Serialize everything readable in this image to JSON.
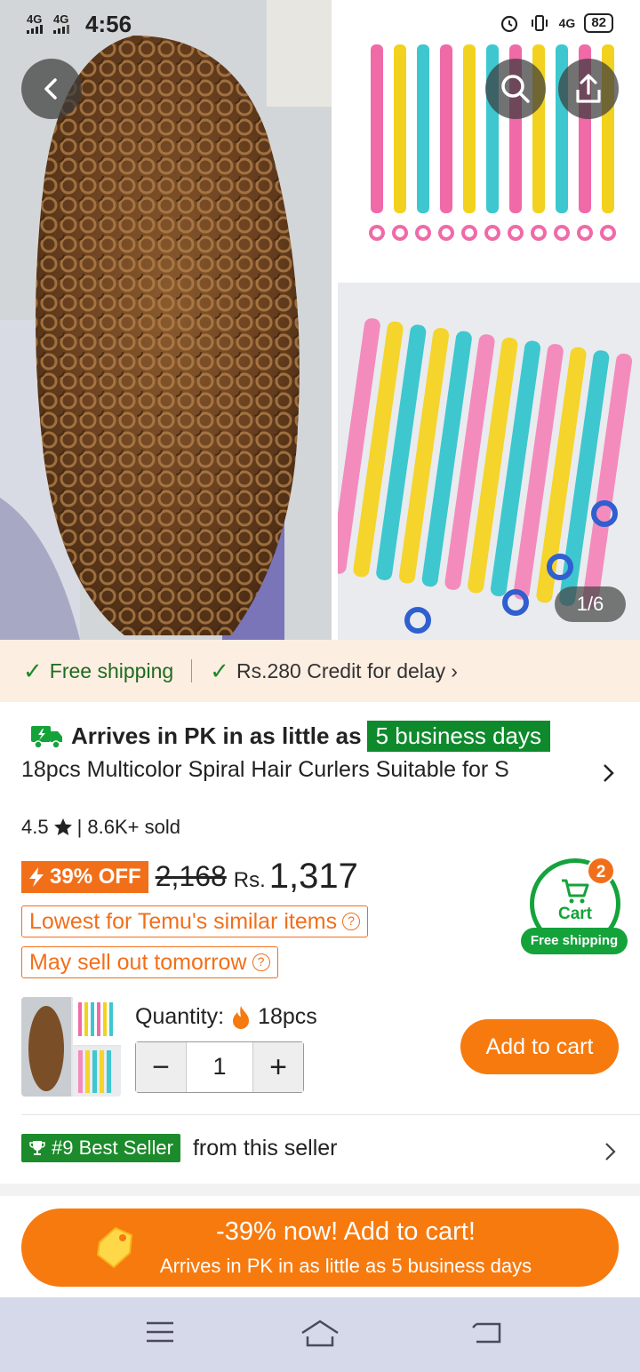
{
  "status_bar": {
    "network_1": "4G",
    "network_2": "4G",
    "time": "4:56",
    "network_3": "4G",
    "battery": "82"
  },
  "gallery": {
    "counter": "1/6"
  },
  "shipping_banner": {
    "free_shipping": "Free shipping",
    "credit": "Rs.280 Credit for delay",
    "credit_arrow": "›"
  },
  "delivery": {
    "prefix": "Arrives in PK in as little as",
    "days": "5 business days"
  },
  "product": {
    "title": "18pcs Multicolor Spiral Hair Curlers Suitable for S"
  },
  "rating": {
    "score": "4.5",
    "sold": "| 8.6K+ sold"
  },
  "price": {
    "discount": "39% OFF",
    "original": "2,168",
    "currency": "Rs.",
    "current": "1,317"
  },
  "tags": {
    "lowest": "Lowest for Temu's similar items",
    "sell_out": "May sell out tomorrow"
  },
  "cart_widget": {
    "count": "2",
    "label": "Cart",
    "free_shipping": "Free shipping"
  },
  "quantity": {
    "label": "Quantity:",
    "option": "18pcs",
    "minus": "−",
    "value": "1",
    "plus": "+"
  },
  "add_to_cart": "Add to cart",
  "seller": {
    "badge": "#9 Best Seller",
    "text": "from this seller"
  },
  "promo": {
    "main": "-39% now! Add to cart!",
    "sub": "Arrives in PK in as little as 5 business days"
  },
  "colors": {
    "accent_orange": "#f77a0e",
    "discount_orange": "#f26f1a",
    "green": "#14a33a",
    "banner_bg": "#fdeee2"
  },
  "icons": [
    "back-icon",
    "search-icon",
    "share-icon",
    "check-icon",
    "truck-icon",
    "chevron-right-icon",
    "star-icon",
    "flame-icon",
    "cart-icon",
    "trophy-icon",
    "price-tag-icon",
    "menu-icon",
    "home-icon",
    "back-nav-icon"
  ]
}
